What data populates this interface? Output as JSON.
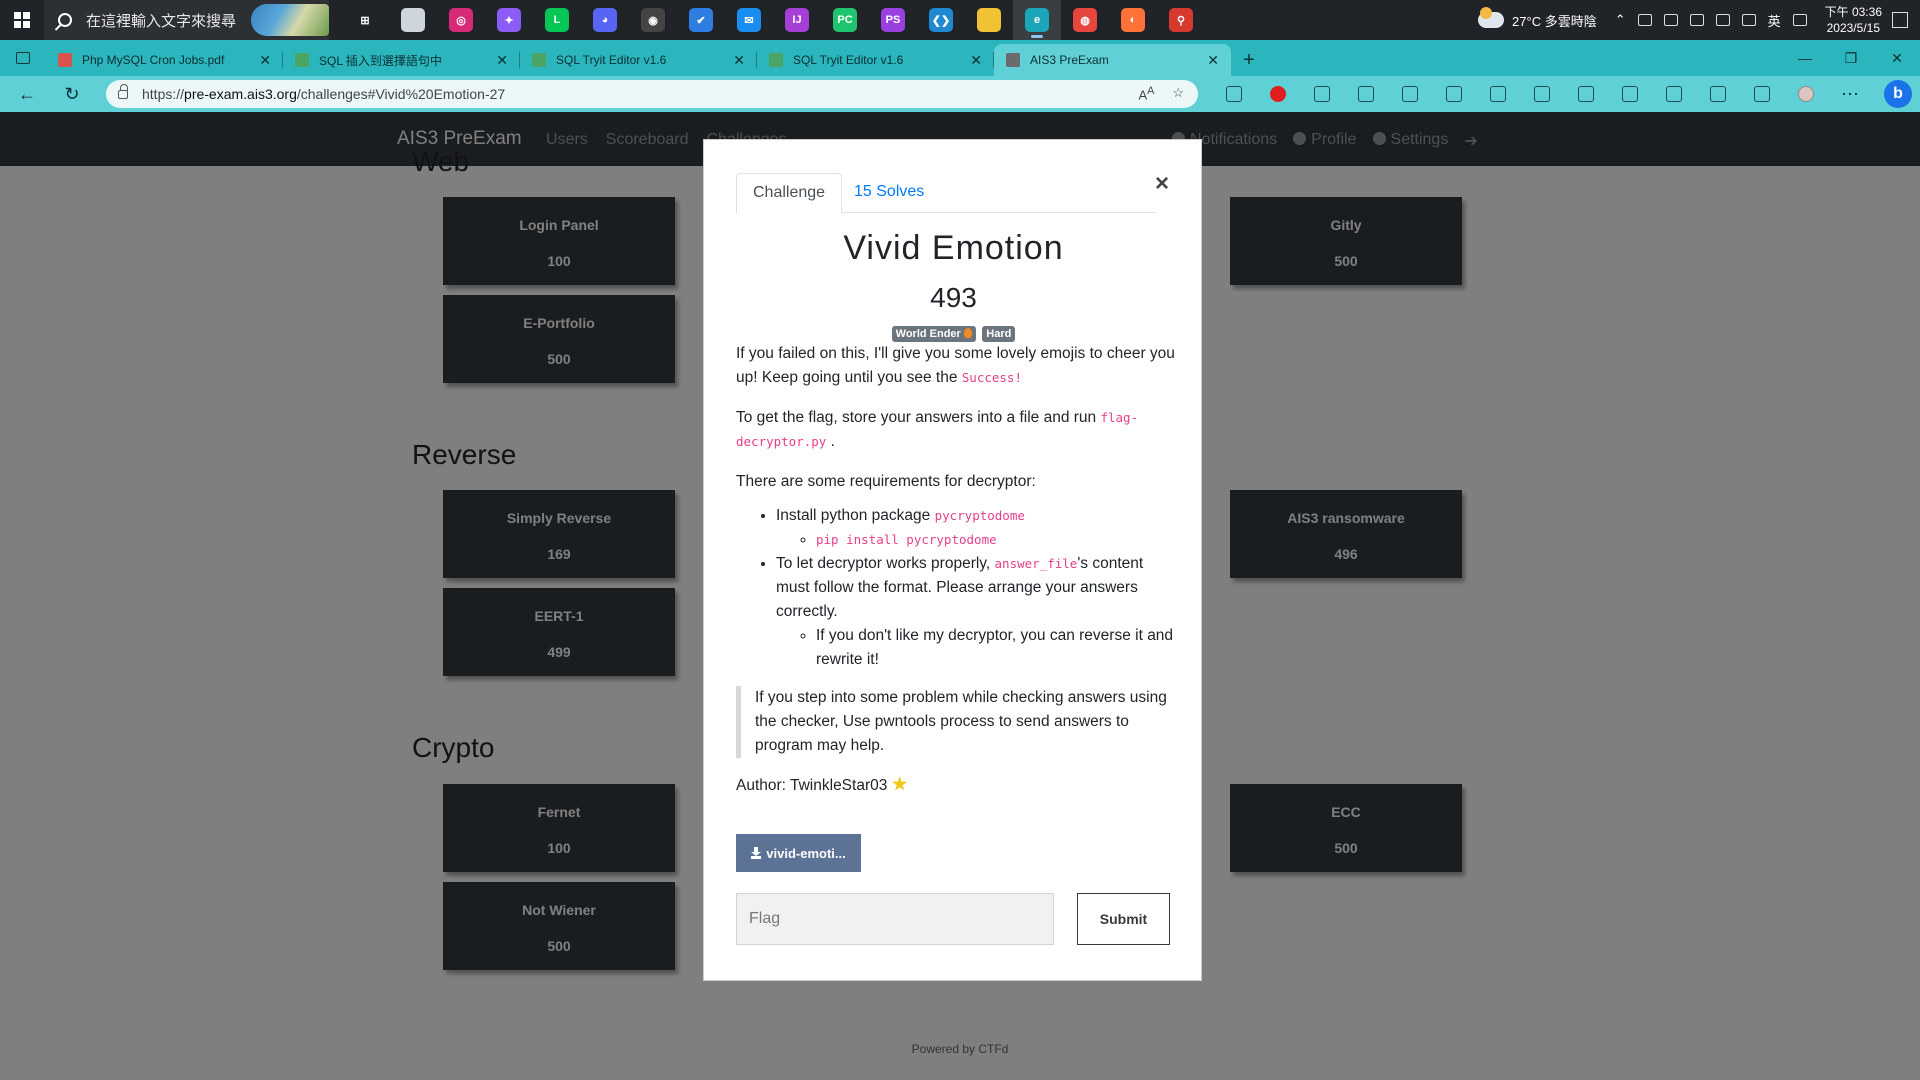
{
  "taskbar": {
    "search_placeholder": "在這裡輸入文字來搜尋",
    "weather": "27°C  多雲時陰",
    "ime": "英",
    "time": "下午 03:36",
    "date": "2023/5/15",
    "apps": [
      {
        "name": "task-view-icon",
        "color": "#202327",
        "glyph": "⊞"
      },
      {
        "name": "notepad-icon",
        "color": "#cfd5dc",
        "glyph": ""
      },
      {
        "name": "instagram-icon",
        "color": "#d62976",
        "glyph": "◎"
      },
      {
        "name": "messenger-icon",
        "color": "#8b5cf6",
        "glyph": "✦"
      },
      {
        "name": "line-icon",
        "color": "#06c755",
        "glyph": "L"
      },
      {
        "name": "discord-icon",
        "color": "#5865f2",
        "glyph": "◕"
      },
      {
        "name": "media-icon",
        "color": "#444",
        "glyph": "◉"
      },
      {
        "name": "todo-icon",
        "color": "#2f7de1",
        "glyph": "✔"
      },
      {
        "name": "mail-icon",
        "color": "#1a8ef0",
        "glyph": "✉"
      },
      {
        "name": "intellij-icon",
        "color": "#a53fd6",
        "glyph": "IJ"
      },
      {
        "name": "pycharm-icon",
        "color": "#20c46e",
        "glyph": "PC"
      },
      {
        "name": "phpstorm-icon",
        "color": "#9a3fe0",
        "glyph": "PS"
      },
      {
        "name": "vscode-icon",
        "color": "#1f8ad2",
        "glyph": "❮❯"
      },
      {
        "name": "explorer-icon",
        "color": "#f1c232",
        "glyph": ""
      },
      {
        "name": "edge-icon",
        "color": "#1aa5b8",
        "glyph": "e"
      },
      {
        "name": "chrome-icon",
        "color": "#e8453c",
        "glyph": "◍"
      },
      {
        "name": "firefox-icon",
        "color": "#ff7139",
        "glyph": "◐"
      },
      {
        "name": "git-icon",
        "color": "#d63a2f",
        "glyph": "⚲"
      }
    ]
  },
  "browser": {
    "tabs": [
      {
        "title": "Php MySQL Cron Jobs.pdf",
        "fav_color": "#d9534f"
      },
      {
        "title": "SQL 插入到選擇語句中",
        "fav_color": "#4aa564"
      },
      {
        "title": "SQL Tryit Editor v1.6",
        "fav_color": "#4aa564"
      },
      {
        "title": "SQL Tryit Editor v1.6",
        "fav_color": "#4aa564"
      },
      {
        "title": "AIS3 PreExam",
        "fav_color": "#6b6b6b"
      }
    ],
    "url_prefix": "https://",
    "url_host": "pre-exam.ais3.org",
    "url_path": "/challenges#Vivid%20Emotion-27"
  },
  "site": {
    "brand": "AIS3 PreExam",
    "nav": [
      "Users",
      "Scoreboard",
      "Challenges"
    ],
    "nav_right": [
      "Notifications",
      "Profile",
      "Settings"
    ],
    "footer": "Powered by CTFd",
    "categories": [
      {
        "title": "Web",
        "cards": [
          {
            "name": "Login Panel",
            "value": "100"
          },
          {
            "name": "Gitly",
            "value": "500"
          },
          {
            "name": "E-Portfolio",
            "value": "500"
          }
        ]
      },
      {
        "title": "Reverse",
        "cards": [
          {
            "name": "Simply Reverse",
            "value": "169"
          },
          {
            "name": "AIS3 ransomware",
            "value": "496"
          },
          {
            "name": "EERT-1",
            "value": "499"
          }
        ]
      },
      {
        "title": "Crypto",
        "cards": [
          {
            "name": "Fernet",
            "value": "100"
          },
          {
            "name": "ECC",
            "value": "500"
          },
          {
            "name": "Not Wiener",
            "value": "500"
          }
        ]
      }
    ]
  },
  "modal": {
    "tab_challenge": "Challenge",
    "tab_solves": "15 Solves",
    "close": "×",
    "title": "Vivid Emotion",
    "points": "493",
    "badge1": "World Ender",
    "badge2": "Hard",
    "p1_a": "If you failed on this, I'll give you some lovely emojis to cheer you up! Keep going until you see the ",
    "p1_code": "Success!",
    "p2_a": "To get the flag, store your answers into a file and run ",
    "p2_code": "flag-decryptor.py",
    "p2_b": " .",
    "p3": "There are some requirements for decryptor:",
    "li1_a": "Install python package ",
    "li1_code": "pycryptodome",
    "li1_sub_code": "pip install pycryptodome",
    "li2_a": "To let decryptor works properly, ",
    "li2_code": "answer_file",
    "li2_b": "'s content must follow the format. Please arrange your answers correctly.",
    "li2_sub": "If you don't like my decryptor, you can reverse it and rewrite it!",
    "quote": "If you step into some problem while checking answers using the checker, Use pwntools process to send answers to program may help.",
    "author": "Author: TwinkleStar03 ",
    "download_label": "vivid-emoti...",
    "flag_placeholder": "Flag",
    "submit_label": "Submit"
  }
}
